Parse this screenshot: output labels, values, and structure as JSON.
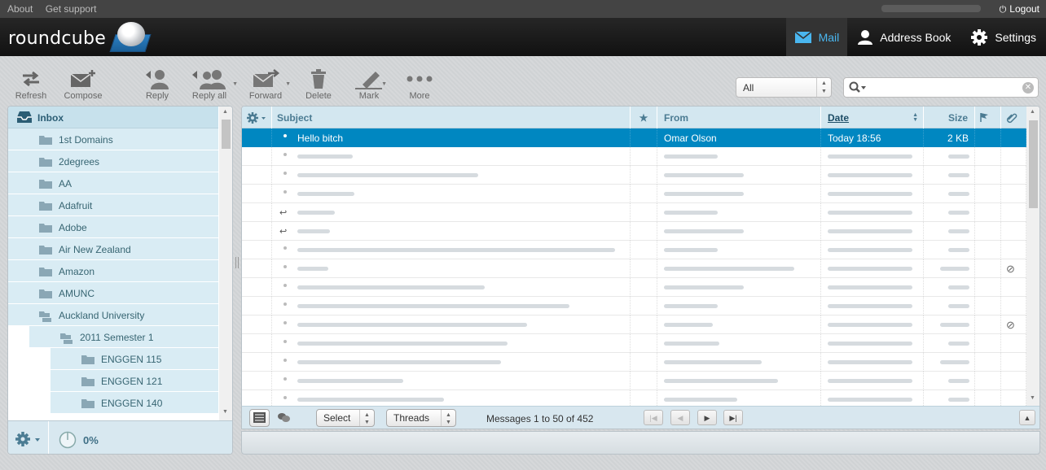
{
  "topline": {
    "about": "About",
    "support": "Get support",
    "logout": "Logout"
  },
  "logo": {
    "text": "roundcube"
  },
  "taskbar": [
    {
      "label": "Mail",
      "icon": "envelope-icon",
      "selected": true
    },
    {
      "label": "Address Book",
      "icon": "person-icon",
      "selected": false
    },
    {
      "label": "Settings",
      "icon": "gear-icon",
      "selected": false
    }
  ],
  "toolbar": {
    "refresh": "Refresh",
    "compose": "Compose",
    "reply": "Reply",
    "reply_all": "Reply all",
    "forward": "Forward",
    "delete": "Delete",
    "mark": "Mark",
    "more": "More"
  },
  "search": {
    "filter": "All",
    "query": ""
  },
  "folders": {
    "inbox": "Inbox",
    "items": [
      {
        "name": "1st Domains"
      },
      {
        "name": "2degrees"
      },
      {
        "name": "AA"
      },
      {
        "name": "Adafruit"
      },
      {
        "name": "Adobe"
      },
      {
        "name": "Air New Zealand"
      },
      {
        "name": "Amazon"
      },
      {
        "name": "AMUNC"
      },
      {
        "name": "Auckland University"
      },
      {
        "name": "2011 Semester 1"
      },
      {
        "name": "ENGGEN 115"
      },
      {
        "name": "ENGGEN 121"
      },
      {
        "name": "ENGGEN 140"
      }
    ],
    "quota": "0%"
  },
  "columns": {
    "subject": "Subject",
    "from": "From",
    "date": "Date",
    "size": "Size"
  },
  "messages": [
    {
      "subject": "Hello bitch",
      "from": "Omar Olson",
      "date": "Today 18:56",
      "size": "2 KB",
      "selected": true
    }
  ],
  "footer": {
    "select": "Select",
    "threads": "Threads",
    "count": "Messages 1 to 50 of 452"
  }
}
